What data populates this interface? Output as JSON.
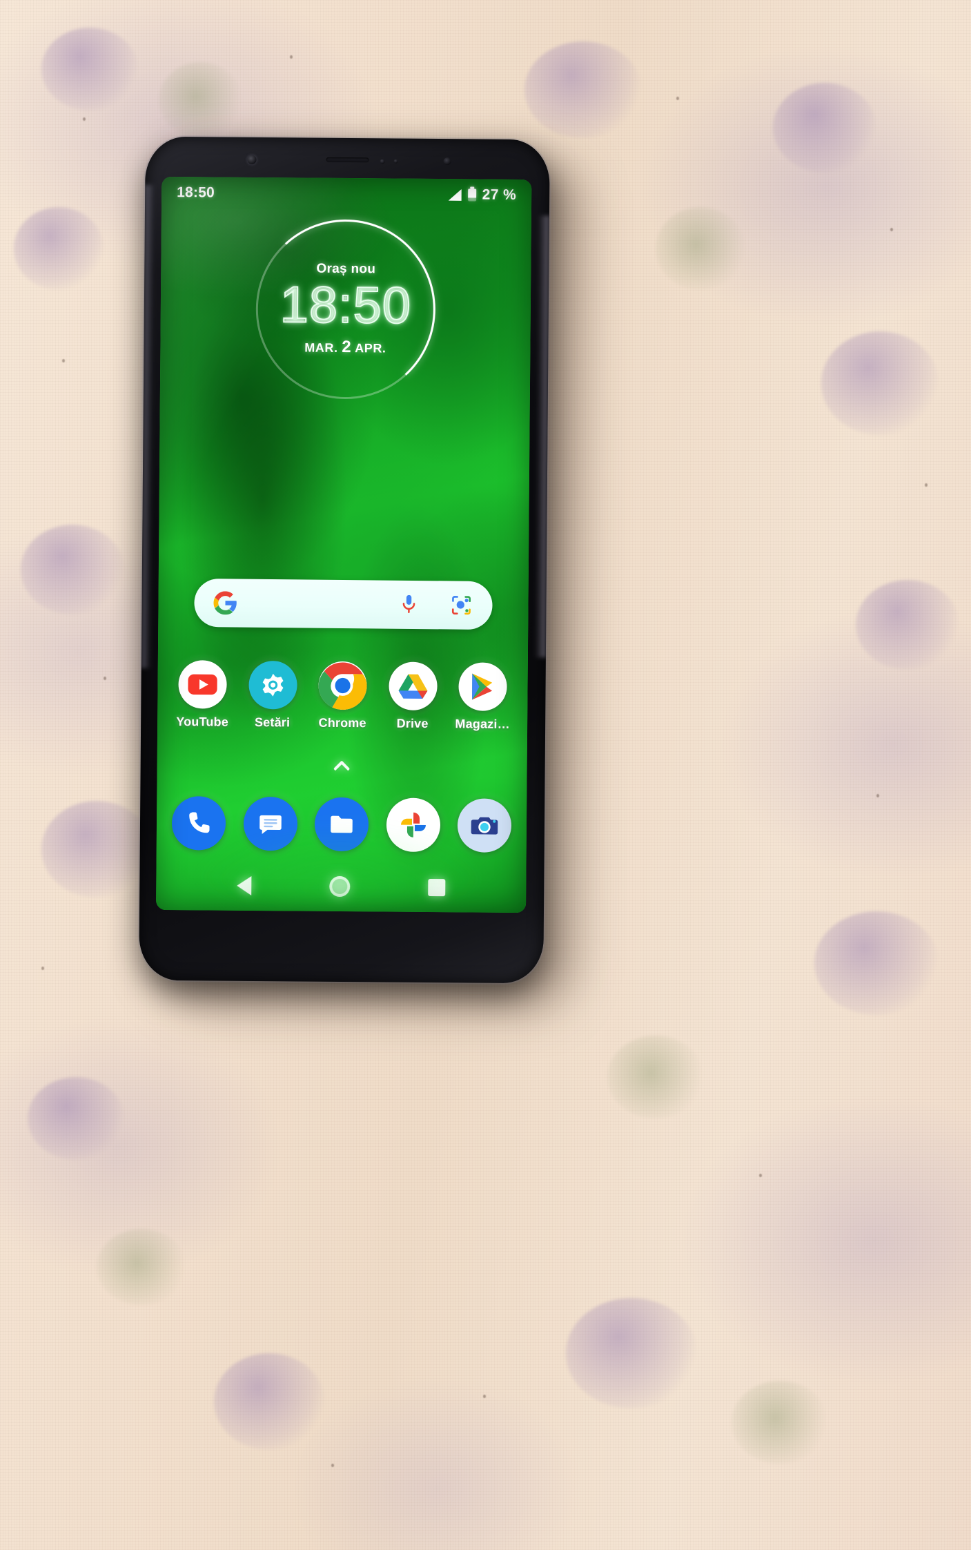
{
  "device": {
    "type": "smartphone",
    "orientation": "portrait",
    "bezel_color": "#0b0b0f"
  },
  "statusbar": {
    "time": "18:50",
    "battery_text": "27 %",
    "signal_icon": "signal-bars-icon",
    "battery_icon": "battery-icon"
  },
  "clock_widget": {
    "city_label": "Oraș nou",
    "time": "18:50",
    "date": {
      "weekday": "MAR.",
      "day": "2",
      "month": "APR."
    }
  },
  "search": {
    "placeholder": "",
    "value": "",
    "google_logo": "google-g-icon",
    "mic_icon": "microphone-icon",
    "lens_icon": "google-lens-icon"
  },
  "apps": [
    {
      "label": "YouTube",
      "icon": "youtube-icon",
      "bg": "#ffffff"
    },
    {
      "label": "Setări",
      "icon": "settings-gear-icon",
      "bg": "#1fbcd4"
    },
    {
      "label": "Chrome",
      "icon": "chrome-icon",
      "bg": "#ffffff"
    },
    {
      "label": "Drive",
      "icon": "google-drive-icon",
      "bg": "#ffffff"
    },
    {
      "label": "Magazi…",
      "icon": "play-store-icon",
      "bg": "#ffffff"
    }
  ],
  "drawer": {
    "chevron_icon": "chevron-up-icon"
  },
  "dock": [
    {
      "name": "Telefon",
      "icon": "phone-icon",
      "bg": "#1a73f0"
    },
    {
      "name": "Mesaje",
      "icon": "messages-icon",
      "bg": "#1a73f0"
    },
    {
      "name": "Fișiere",
      "icon": "files-folder-icon",
      "bg": "#1a73f0"
    },
    {
      "name": "Fotografii",
      "icon": "google-photos-icon",
      "bg": "#ffffff"
    },
    {
      "name": "Cameră",
      "icon": "camera-icon",
      "bg": "#cfe0f5"
    }
  ],
  "navbar": {
    "back": "back-triangle-icon",
    "home": "home-circle-icon",
    "recents": "recents-square-icon"
  },
  "colors": {
    "wallpaper_green": "#1cc02c",
    "accent_white": "#ffffff",
    "dock_blue": "#1a73f0",
    "settings_cyan": "#1fbcd4"
  }
}
